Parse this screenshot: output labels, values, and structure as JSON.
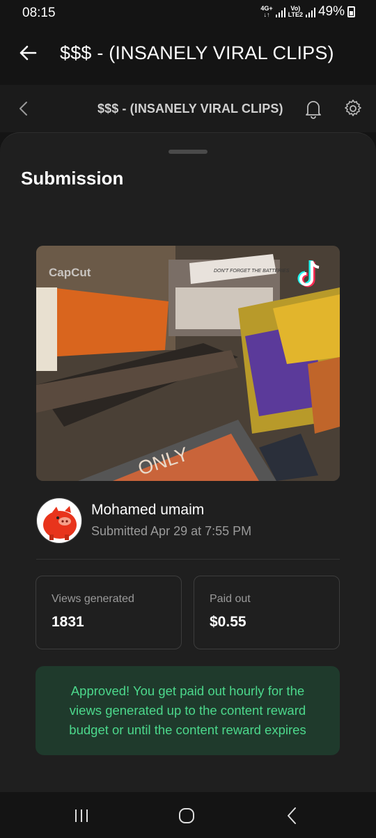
{
  "status_bar": {
    "time": "08:15",
    "network_top": "4G+",
    "network_bottom": "LTE2",
    "volte": "Vo)",
    "battery": "49%"
  },
  "app_bar": {
    "title": "$$$ - (INSANELY VIRAL CLIPS)",
    "back_icon": "arrow-left-icon"
  },
  "sub_header": {
    "title": "$$$ - (INSANELY VIRAL CLIPS)",
    "back_icon": "chevron-left-icon",
    "bell_icon": "bell-icon",
    "settings_icon": "gear-icon"
  },
  "sheet": {
    "title": "Submission"
  },
  "video": {
    "watermark": "CapCut",
    "store_sign": "DON'T FORGET THE BATTERIES",
    "register_text": "ONLY",
    "platform_icon": "tiktok-icon"
  },
  "submitter": {
    "name": "Mohamed umaim",
    "submitted": "Submitted Apr 29 at 7:55 PM",
    "avatar_icon": "pig-avatar-icon"
  },
  "stats": {
    "views_label": "Views generated",
    "views_value": "1831",
    "paid_label": "Paid out",
    "paid_value": "$0.55"
  },
  "approved": {
    "message": "Approved! You get paid out hourly for the views generated up to the content reward budget or until the content reward expires"
  },
  "nav": {
    "recent_icon": "recent-apps-icon",
    "home_icon": "home-icon",
    "back_icon": "back-chevron-icon"
  },
  "colors": {
    "background": "#141414",
    "sheet": "#1f1f1f",
    "approved_bg": "#1f3a2c",
    "approved_text": "#4cd88c"
  }
}
